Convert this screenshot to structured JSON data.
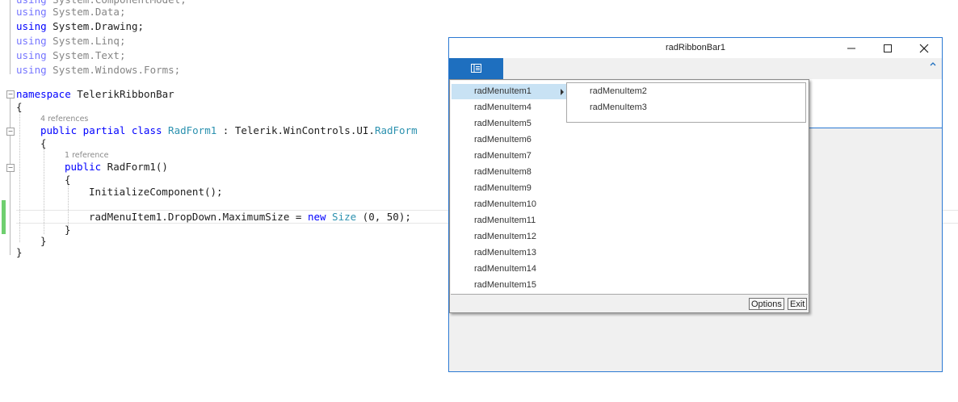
{
  "editor": {
    "lines": [
      {
        "text": "using System.ComponentModel;",
        "dim": true
      },
      {
        "kw": "using",
        "rest": " System.Data;",
        "dim": true
      },
      {
        "kw": "using",
        "rest": " System.Drawing;",
        "dim": false
      },
      {
        "kw": "using",
        "rest": " System.Linq;",
        "dim": true
      },
      {
        "kw": "using",
        "rest": " System.Text;",
        "dim": true
      },
      {
        "kw": "using",
        "rest": " System.Windows.Forms;",
        "dim": true
      }
    ],
    "namespace_kw": "namespace",
    "namespace_name": " TelerikRibbonBar",
    "brace_open": "{",
    "brace_close": "}",
    "class_refs": "4 references",
    "class_kw": "public partial class",
    "class_name": "RadForm1",
    "class_sep": " : Telerik.WinControls.UI.",
    "class_base": "RadForm",
    "ctor_refs": "1 reference",
    "ctor_kw": "public",
    "ctor_name": " RadForm1()",
    "init_call": "InitializeComponent();",
    "stmt_start": "radMenuItem1.DropDown.MaximumSize = ",
    "stmt_new": "new",
    "stmt_type": "Size",
    "stmt_end": " (0, 50);"
  },
  "form": {
    "title": "radRibbonBar1",
    "minimize_glyph": "─",
    "maximize_glyph": "☐",
    "close_glyph": "✕",
    "collapse_glyph": "^"
  },
  "menu": {
    "items": [
      {
        "label": "radMenuItem1",
        "active": true,
        "has_submenu": true
      },
      {
        "label": "radMenuItem4"
      },
      {
        "label": "radMenuItem5"
      },
      {
        "label": "radMenuItem6"
      },
      {
        "label": "radMenuItem7"
      },
      {
        "label": "radMenuItem8"
      },
      {
        "label": "radMenuItem9"
      },
      {
        "label": "radMenuItem10"
      },
      {
        "label": "radMenuItem11"
      },
      {
        "label": "radMenuItem12"
      },
      {
        "label": "radMenuItem13"
      },
      {
        "label": "radMenuItem14"
      },
      {
        "label": "radMenuItem15"
      }
    ],
    "submenu_items": [
      {
        "label": "radMenuItem2"
      },
      {
        "label": "radMenuItem3"
      }
    ],
    "options_label": "Options",
    "exit_label": "Exit"
  },
  "colors": {
    "accent": "#1e6fbf",
    "active_item": "#c8e2f4",
    "keyword": "#0000ff",
    "type": "#2b91af"
  }
}
